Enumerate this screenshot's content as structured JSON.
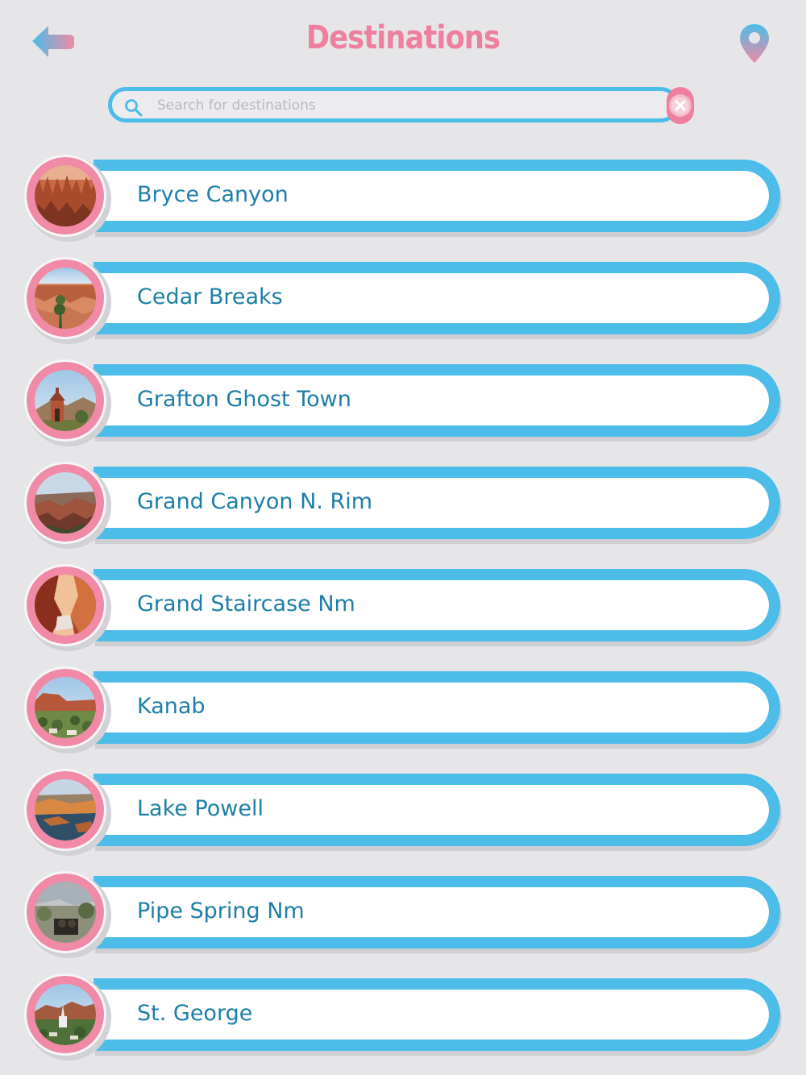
{
  "header": {
    "title": "Destinations",
    "back_icon": "back-arrow-icon",
    "location_icon": "map-pin-icon"
  },
  "search": {
    "placeholder": "Search for destinations",
    "value": "",
    "search_icon": "search-icon",
    "clear_icon": "clear-icon"
  },
  "colors": {
    "background": "#e6e6e8",
    "accent_blue": "#4cbde8",
    "accent_pink": "#ee7f9f",
    "label_text": "#1d7ea8"
  },
  "destinations": [
    {
      "label": "Bryce Canyon"
    },
    {
      "label": "Cedar Breaks"
    },
    {
      "label": "Grafton Ghost Town"
    },
    {
      "label": "Grand Canyon N. Rim"
    },
    {
      "label": "Grand Staircase Nm"
    },
    {
      "label": "Kanab"
    },
    {
      "label": "Lake Powell"
    },
    {
      "label": "Pipe Spring Nm"
    },
    {
      "label": "St. George"
    }
  ]
}
